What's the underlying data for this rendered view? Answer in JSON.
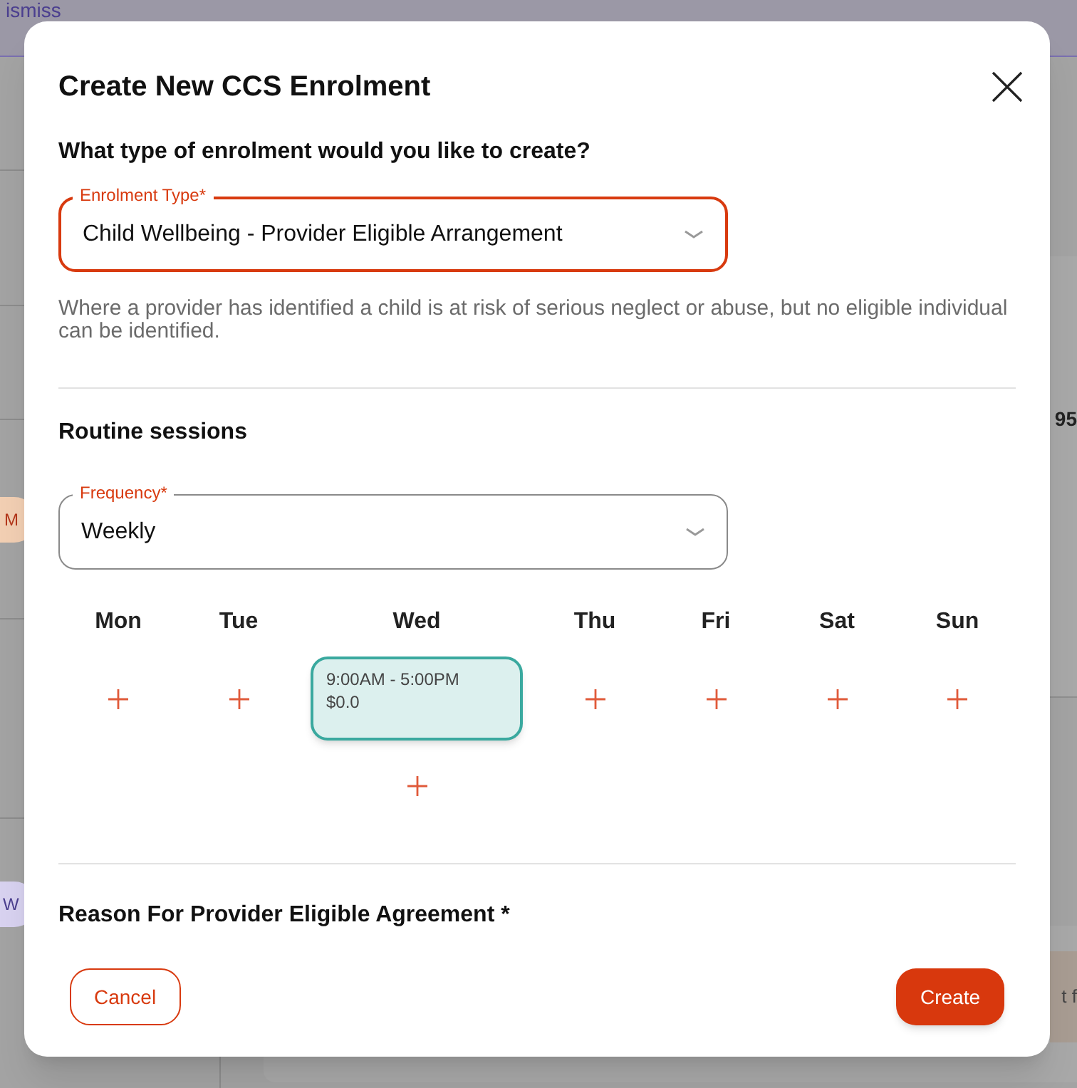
{
  "background": {
    "top_bar_text": "ismiss",
    "avatars": [
      {
        "initial": "M",
        "color": "#f2cfb3"
      },
      {
        "initial": "W",
        "color": "#d8d2f0"
      }
    ],
    "card_text": "95",
    "chip_text": "t f"
  },
  "dialog": {
    "title": "Create New CCS Enrolment",
    "question": "What type of enrolment would you like to create?",
    "enrolment_type": {
      "label": "Enrolment Type*",
      "value": "Child Wellbeing - Provider Eligible Arrangement",
      "focused": true
    },
    "description": "Where a provider has identified a child is at risk of serious neglect or abuse, but no eligible individual can be identified.",
    "routine_heading": "Routine sessions",
    "frequency": {
      "label": "Frequency*",
      "value": "Weekly",
      "focused": false
    },
    "days": [
      {
        "label": "Mon"
      },
      {
        "label": "Tue"
      },
      {
        "label": "Wed",
        "sessions": [
          {
            "time": "9:00AM - 5:00PM",
            "amount": "$0.0"
          }
        ]
      },
      {
        "label": "Thu"
      },
      {
        "label": "Fri"
      },
      {
        "label": "Sat"
      },
      {
        "label": "Sun"
      }
    ],
    "reason_heading": "Reason For Provider Eligible Agreement *",
    "buttons": [
      {
        "label": "Cancel",
        "kind": "secondary"
      },
      {
        "label": "Create",
        "kind": "primary"
      }
    ]
  }
}
